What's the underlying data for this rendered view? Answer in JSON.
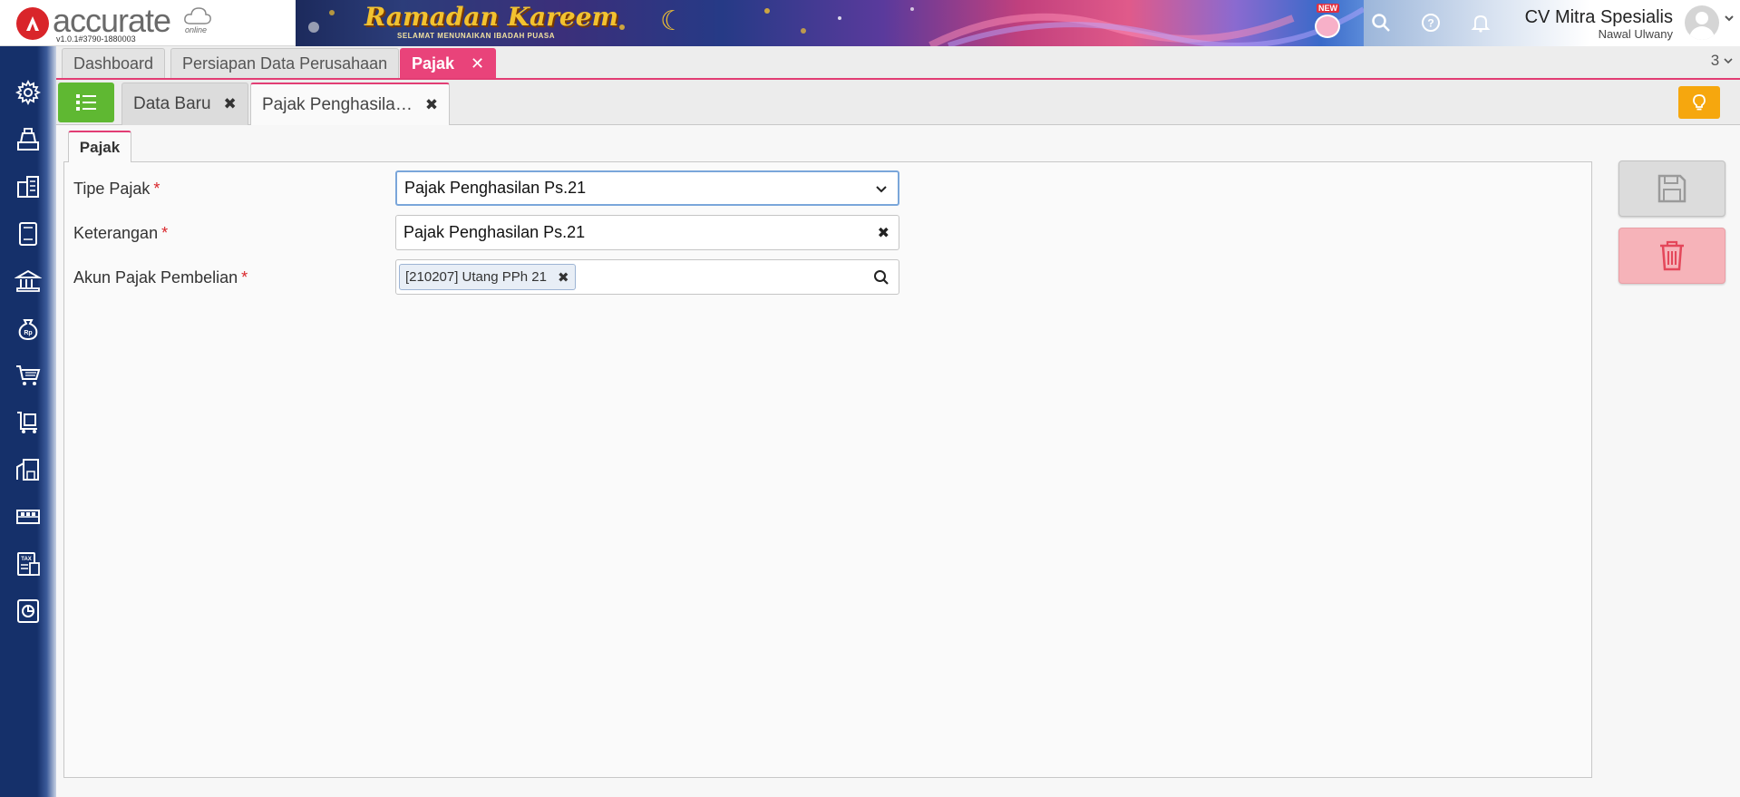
{
  "app": {
    "brand": "accurate",
    "brand_sub": "online",
    "version": "v1.0.1#3790-1880003"
  },
  "banner": {
    "title": "Ramadan Kareem",
    "subtitle": "SELAMAT MENUNAIKAN IBADAH PUASA",
    "badge": "NEW"
  },
  "header": {
    "company": "CV Mitra Spesialis",
    "user": "Nawal Ulwany"
  },
  "sidebar": {
    "items": [
      {
        "icon": "gear-icon"
      },
      {
        "icon": "cash-register-icon"
      },
      {
        "icon": "building-icon"
      },
      {
        "icon": "ledger-book-icon"
      },
      {
        "icon": "bank-icon"
      },
      {
        "icon": "money-bag-icon"
      },
      {
        "icon": "shopping-cart-icon"
      },
      {
        "icon": "delivery-cart-icon"
      },
      {
        "icon": "warehouse-icon"
      },
      {
        "icon": "production-icon"
      },
      {
        "icon": "tax-icon"
      },
      {
        "icon": "report-chart-icon"
      }
    ]
  },
  "module_tabs": {
    "items": [
      {
        "label": "Dashboard"
      },
      {
        "label": "Persiapan Data Perusahaan"
      },
      {
        "label": "Pajak"
      }
    ],
    "count": "3"
  },
  "doc_tabs": {
    "items": [
      {
        "label": "Data Baru"
      },
      {
        "label": "Pajak Penghasila…"
      }
    ]
  },
  "form": {
    "tab_label": "Pajak",
    "fields": {
      "tipe_pajak": {
        "label": "Tipe Pajak",
        "value": "Pajak Penghasilan Ps.21"
      },
      "keterangan": {
        "label": "Keterangan",
        "value": "Pajak Penghasilan Ps.21"
      },
      "akun_pajak": {
        "label": "Akun Pajak Pembelian",
        "chip": "[210207] Utang PPh 21"
      }
    },
    "required_mark": "*"
  },
  "colors": {
    "accent": "#e23d74",
    "sidebar": "#15306a",
    "list_button": "#5fb832",
    "tip_button": "#f6a70e",
    "delete": "#f6b3b9"
  }
}
